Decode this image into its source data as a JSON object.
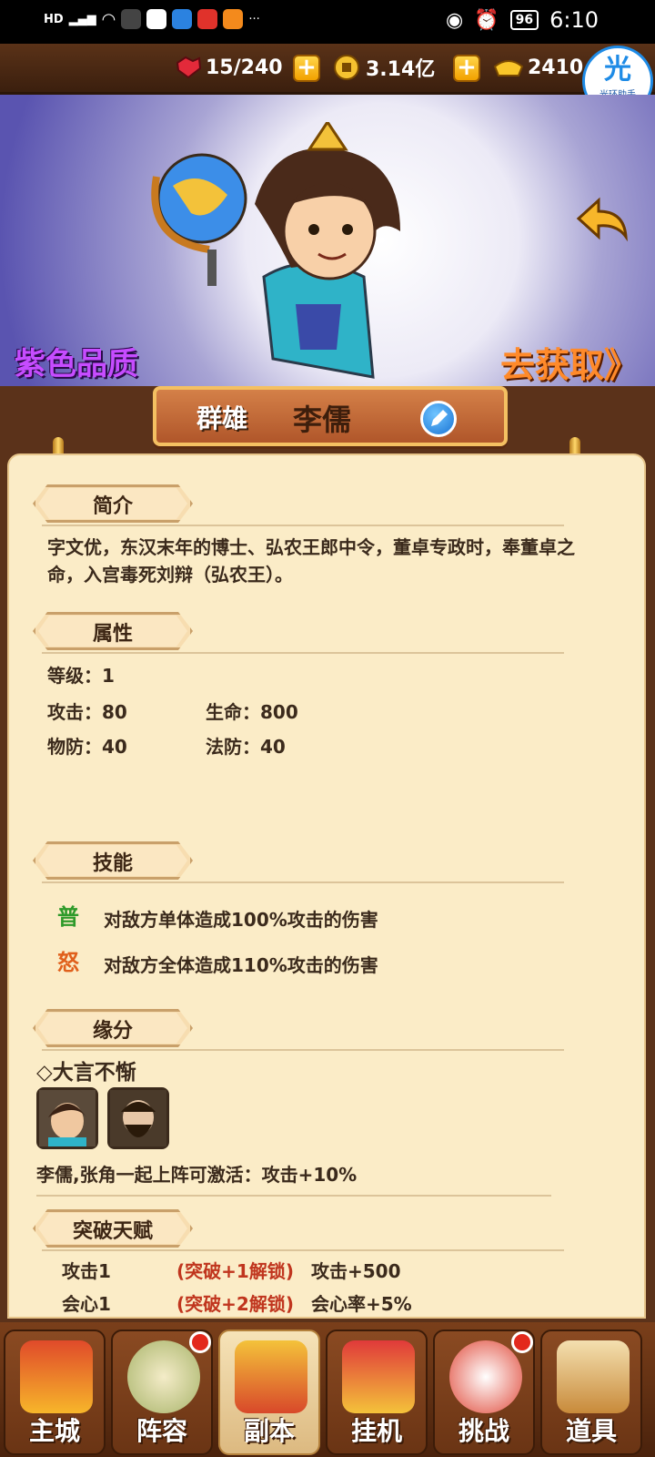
{
  "status_bar": {
    "time": "6:10",
    "battery": "96",
    "more": "···"
  },
  "resources": {
    "stamina": "15/240",
    "coins": "3.14亿",
    "gold": "2410"
  },
  "helper": {
    "title": "光",
    "subtitle": "光环助手"
  },
  "hero": {
    "quality": "紫色品质",
    "get_link": "去获取》",
    "faction": "群雄",
    "name": "李儒"
  },
  "sections": {
    "intro": {
      "title": "简介",
      "text": "字文优，东汉末年的博士、弘农王郎中令，董卓专政时，奉董卓之命，入宫毒死刘辩（弘农王）。"
    },
    "attributes": {
      "title": "属性",
      "level": "等级：1",
      "attack": "攻击：80",
      "hp": "生命：800",
      "pdef": "物防：40",
      "mdef": "法防：40"
    },
    "skills": {
      "title": "技能",
      "items": [
        {
          "icon": "普",
          "text": "对敌方单体造成100%攻击的伤害"
        },
        {
          "icon": "怒",
          "text": "对敌方全体造成110%攻击的伤害"
        }
      ]
    },
    "fate": {
      "title": "缘分",
      "name": "◇大言不惭",
      "desc": "李儒,张角一起上阵可激活：攻击+10%"
    },
    "talent": {
      "title": "突破天赋",
      "rows": [
        {
          "name": "攻击1",
          "cond": "(突破+1解锁)",
          "effect": "攻击+500"
        },
        {
          "name": "会心1",
          "cond": "(突破+2解锁)",
          "effect": "会心率+5%"
        }
      ]
    }
  },
  "nav": [
    {
      "label": "主城",
      "badge": false
    },
    {
      "label": "阵容",
      "badge": true
    },
    {
      "label": "副本",
      "badge": false
    },
    {
      "label": "挂机",
      "badge": false
    },
    {
      "label": "挑战",
      "badge": true
    },
    {
      "label": "道具",
      "badge": false
    }
  ],
  "colors": {
    "quality": "#c64cff",
    "get_link": "#ff8a2a",
    "accent_red": "#c0351e"
  }
}
